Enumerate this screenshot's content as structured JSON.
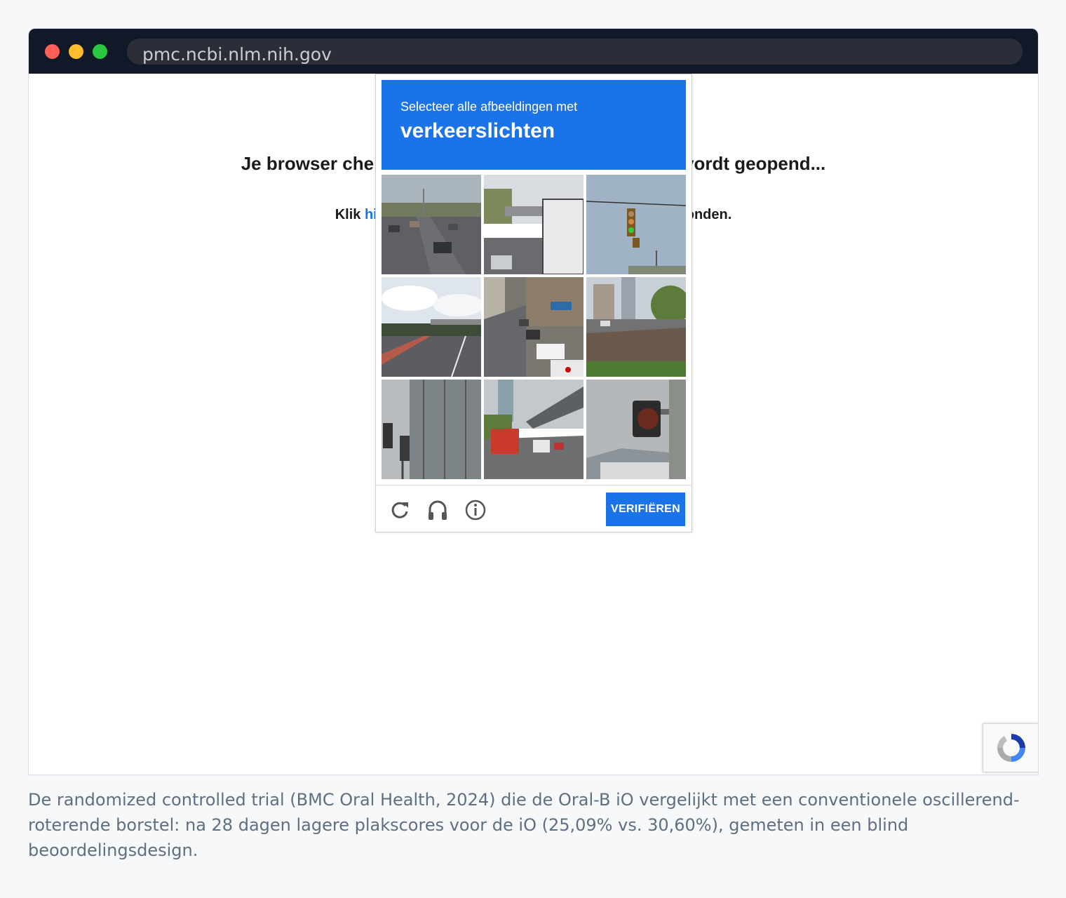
{
  "browser": {
    "url": "pmc.ncbi.nlm.nih.gov"
  },
  "page": {
    "heading_left": "Je browser che",
    "heading_right": "vordt geopend...",
    "subline_prefix": "Klik ",
    "subline_link": "hier",
    "subline_suffix": "conden."
  },
  "captcha": {
    "instruction": "Selecteer alle afbeeldingen met",
    "target": "verkeerslichten",
    "verify_label": "VERIFIËREN",
    "header_color": "#1a73e8",
    "icons": [
      "reload-icon",
      "headphones-icon",
      "info-icon"
    ],
    "tiles": [
      {
        "scene": "highway-traffic"
      },
      {
        "scene": "truck-overpass"
      },
      {
        "scene": "hanging-traffic-light"
      },
      {
        "scene": "cloudy-road-overpass"
      },
      {
        "scene": "parked-cars-street"
      },
      {
        "scene": "city-street-greenery"
      },
      {
        "scene": "traffic-light-building"
      },
      {
        "scene": "bus-under-overpass"
      },
      {
        "scene": "traffic-light-closeup"
      }
    ]
  },
  "caption": "De randomized controlled trial (BMC Oral Health, 2024) die de Oral-B iO vergelijkt met een conventionele oscillerend-roterende borstel: na 28 dagen lagere plakscores voor de iO (25,09% vs. 30,60%), gemeten in een blind beoordelingsdesign."
}
